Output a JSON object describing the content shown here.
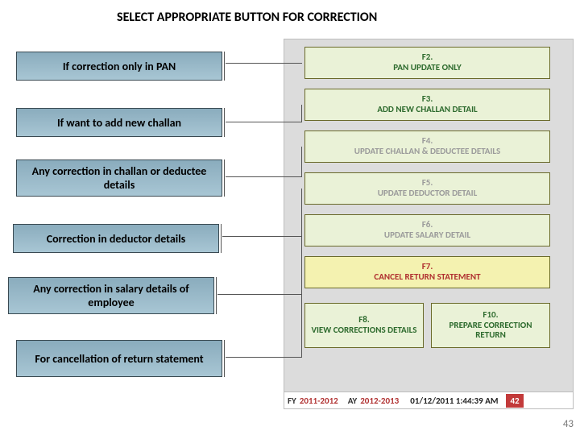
{
  "title": "SELECT APPROPRIATE BUTTON FOR CORRECTION",
  "left": {
    "l1": "If correction only in PAN",
    "l2": "If want to add new challan",
    "l3": "Any correction in challan or deductee details",
    "l4": "Correction in deductor details",
    "l5": "Any correction in salary details of employee",
    "l6": "For cancellation of return statement"
  },
  "buttons": {
    "b1": {
      "key": "F2.",
      "label": "PAN UPDATE ONLY"
    },
    "b2": {
      "key": "F3.",
      "label": "ADD NEW CHALLAN DETAIL"
    },
    "b3": {
      "key": "F4.",
      "label": "UPDATE CHALLAN & DEDUCTEE DETAILS"
    },
    "b4": {
      "key": "F5.",
      "label": "UPDATE DEDUCTOR DETAIL"
    },
    "b5": {
      "key": "F6.",
      "label": "UPDATE SALARY DETAIL"
    },
    "b6": {
      "key": "F7.",
      "label": "CANCEL RETURN STATEMENT"
    },
    "b7": {
      "key": "F8.",
      "label": "VIEW CORRECTIONS DETAILS"
    },
    "b8": {
      "key": "F10.",
      "label": "PREPARE CORRECTION RETURN"
    }
  },
  "status": {
    "fy_label": "FY",
    "fy_value": "2011-2012",
    "ay_label": "AY",
    "ay_value": "2012-2013",
    "datetime": "01/12/2011 1:44:39 AM",
    "badge": "42"
  },
  "page_count": "43"
}
